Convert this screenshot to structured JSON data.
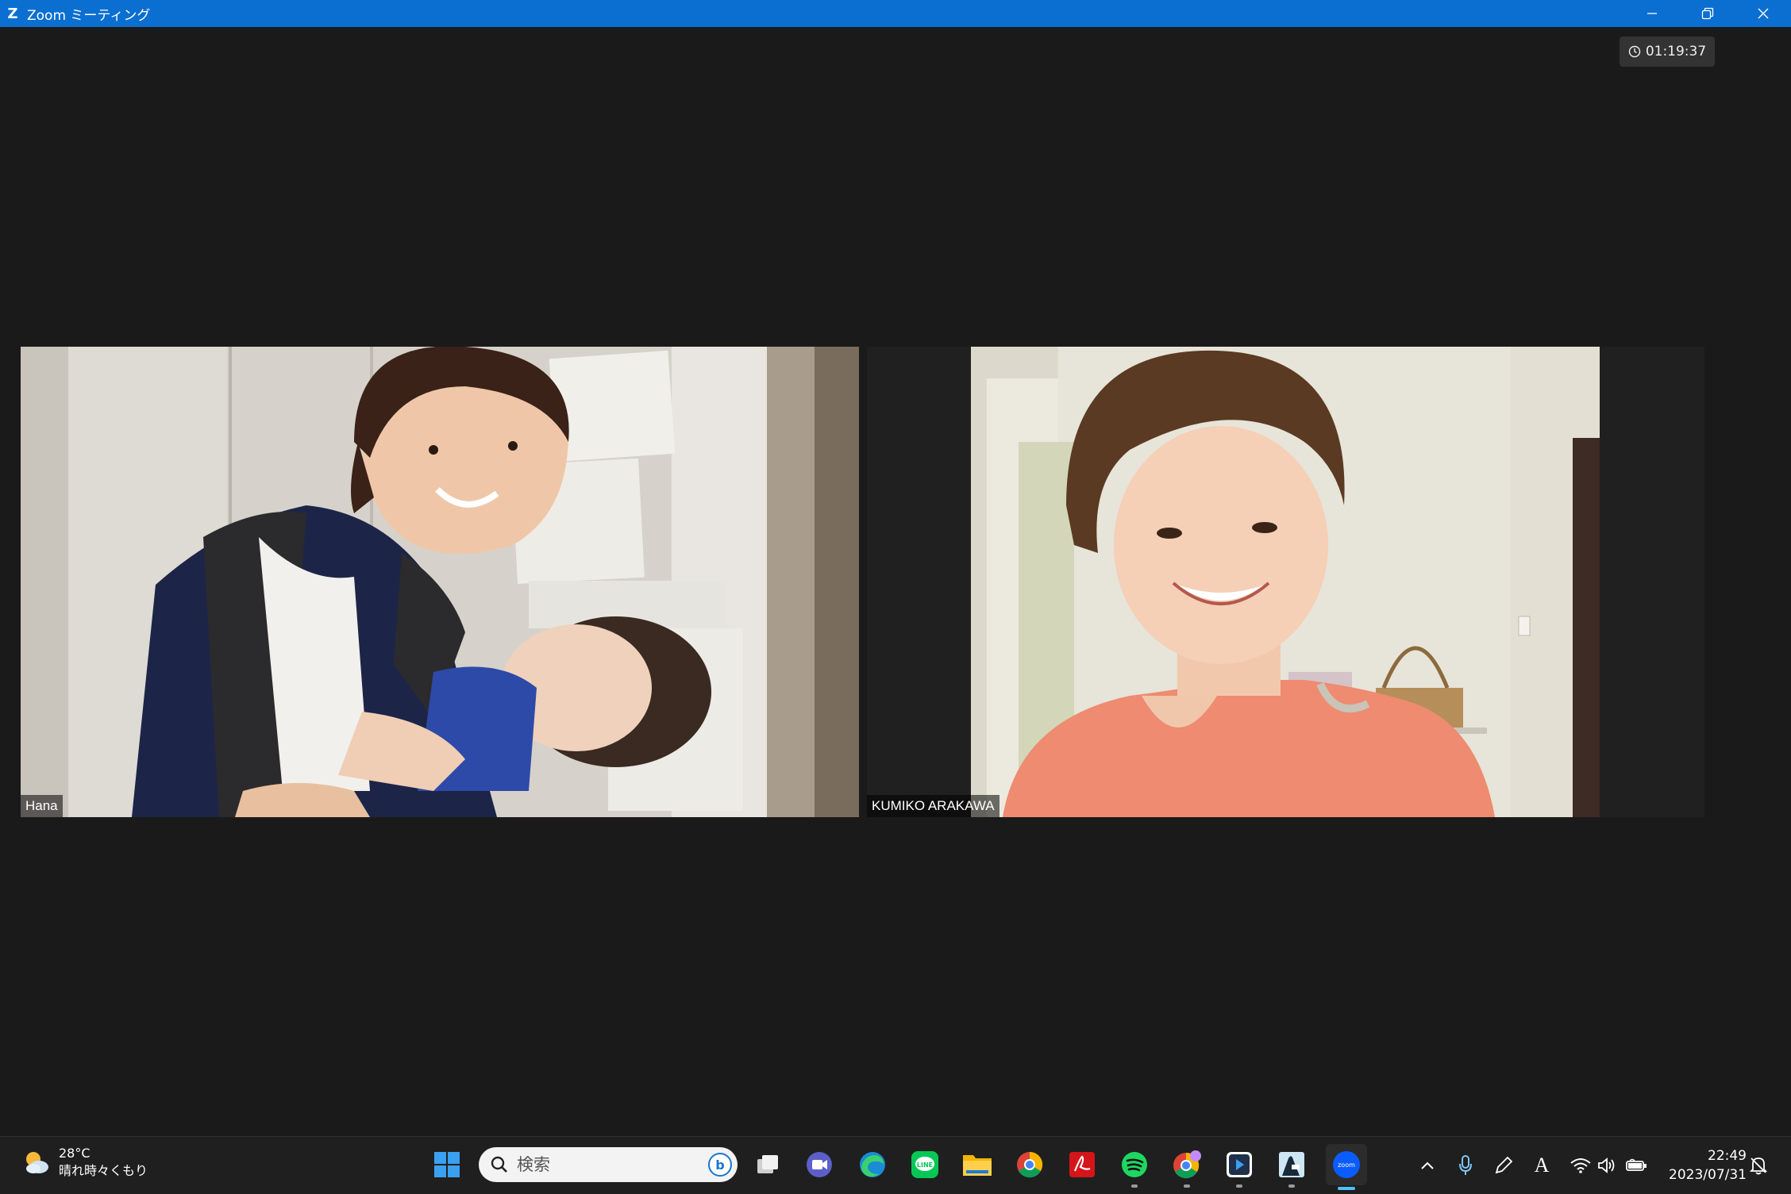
{
  "window": {
    "title": "Zoom ミーティング",
    "app_icon": "zoom-logo",
    "controls": [
      "minimize-icon",
      "restore-icon",
      "close-icon"
    ],
    "accent_color": "#0b6fd1"
  },
  "meeting": {
    "timer_icon": "clock-icon",
    "elapsed": "01:19:37"
  },
  "participants": [
    {
      "name": "Hana"
    },
    {
      "name": "KUMIKO ARAKAWA"
    }
  ],
  "taskbar": {
    "weather": {
      "temperature": "28°C",
      "condition": "晴れ時々くもり",
      "icon": "partly-cloudy-icon"
    },
    "search": {
      "placeholder": "検索"
    },
    "apps": [
      "start-icon",
      "task-view-icon",
      "teams-icon",
      "edge-icon",
      "line-icon",
      "file-explorer-icon",
      "chrome-icon",
      "acrobat-icon",
      "spotify-icon",
      "chrome-profile-icon",
      "app-store-icon",
      "kindle-icon",
      "zoom-icon"
    ],
    "tray_icons": [
      "show-hidden-icon",
      "microphone-icon",
      "pen-icon",
      "ime-icon",
      "wifi-icon",
      "volume-icon",
      "battery-icon",
      "notification-icon"
    ],
    "ime_label": "A",
    "time": "22:49",
    "date": "2023/07/31"
  }
}
